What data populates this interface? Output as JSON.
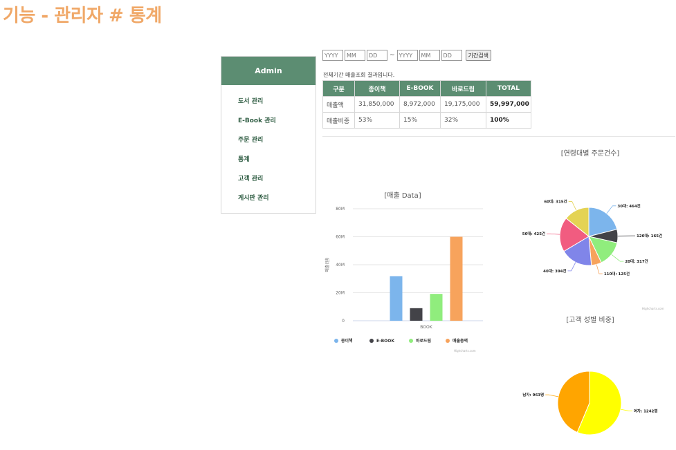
{
  "slide": {
    "title": "기능 - 관리자 # 통계"
  },
  "sidebar": {
    "header": "Admin",
    "items": [
      {
        "label": "도서 관리"
      },
      {
        "label": "E-Book 관리"
      },
      {
        "label": "주문 관리"
      },
      {
        "label": "통계"
      },
      {
        "label": "고객 관리"
      },
      {
        "label": "게시판 관리"
      }
    ]
  },
  "search": {
    "yyyy_placeholder": "YYYY",
    "mm_placeholder": "MM",
    "dd_placeholder": "DD",
    "separator": "~",
    "button_label": "기간검색"
  },
  "result_text": "전체기간 매출조회 결과입니다.",
  "table": {
    "headers": [
      "구분",
      "종이책",
      "E-BOOK",
      "바로드림",
      "TOTAL"
    ],
    "rows": [
      [
        "매출액",
        "31,850,000",
        "8,972,000",
        "19,175,000",
        "59,997,000"
      ],
      [
        "매출비중",
        "53%",
        "15%",
        "32%",
        "100%"
      ]
    ]
  },
  "credits": "Highcharts.com",
  "chart_data": [
    {
      "type": "bar",
      "title": "[매출 Data]",
      "categories": [
        "BOOK"
      ],
      "ylabel": "매출(원)",
      "ylim": [
        0,
        80000000
      ],
      "yticks": [
        "0",
        "20M",
        "40M",
        "60M",
        "80M"
      ],
      "grid": true,
      "legend_position": "bottom",
      "series": [
        {
          "name": "종이책",
          "values": [
            31850000
          ],
          "color": "#7cb5ec"
        },
        {
          "name": "E-BOOK",
          "values": [
            8972000
          ],
          "color": "#434348"
        },
        {
          "name": "바로드림",
          "values": [
            19175000
          ],
          "color": "#90ed7d"
        },
        {
          "name": "매출총액",
          "values": [
            59997000
          ],
          "color": "#f7a35c"
        }
      ]
    },
    {
      "type": "pie",
      "title": "[연령대별 주문건수]",
      "slices": [
        {
          "label": "30대: 464건",
          "value": 464,
          "color": "#7cb5ec"
        },
        {
          "label": "120대: 165건",
          "value": 165,
          "color": "#434348"
        },
        {
          "label": "20대: 317건",
          "value": 317,
          "color": "#90ed7d"
        },
        {
          "label": "110대: 125건",
          "value": 125,
          "color": "#f7a35c"
        },
        {
          "label": "40대: 394건",
          "value": 394,
          "color": "#8085e9"
        },
        {
          "label": "50대: 425건",
          "value": 425,
          "color": "#f15c80"
        },
        {
          "label": "60대: 315건",
          "value": 315,
          "color": "#e4d354"
        }
      ]
    },
    {
      "type": "pie",
      "title": "[고객 성별 비중]",
      "slices": [
        {
          "label": "여자: 1242명",
          "value": 1242,
          "color": "#ffff00"
        },
        {
          "label": "남자: 963명",
          "value": 963,
          "color": "#ffa500"
        }
      ]
    }
  ]
}
